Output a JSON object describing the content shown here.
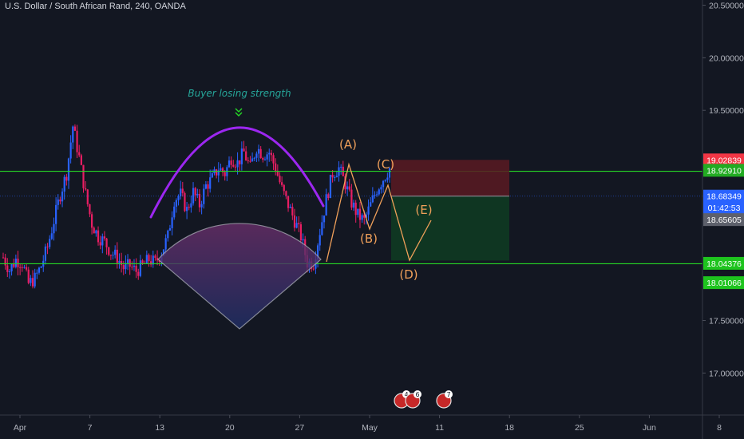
{
  "header": {
    "title": "U.S. Dollar / South African Rand, 240, OANDA"
  },
  "colors": {
    "background": "#131722",
    "up": "#2962ff",
    "down": "#e91e63",
    "support": "#26d926",
    "arc": "#9c27f0",
    "wave": "#f0a05a",
    "loss_zone": "#5a1a22",
    "profit_zone": "#0f3a22",
    "annotation": "#26a69a"
  },
  "chart_data": {
    "type": "candlestick",
    "title": "U.S. Dollar / South African Rand, 240, OANDA",
    "ylim": [
      16.6,
      20.55
    ],
    "y_ticks": [
      "20.50000",
      "20.00000",
      "19.50000",
      "17.50000",
      "17.00000"
    ],
    "x_ticks": [
      "Apr",
      "7",
      "13",
      "20",
      "27",
      "May",
      "11",
      "18",
      "25",
      "Jun",
      "8"
    ],
    "candle_series": [
      18.1,
      17.98,
      18.08,
      18.05,
      17.85,
      17.9,
      18.02,
      18.2,
      18.45,
      18.7,
      18.9,
      19.35,
      19.05,
      18.7,
      18.42,
      18.3,
      18.25,
      18.15,
      18.1,
      18.0,
      18.02,
      17.97,
      18.02,
      18.08,
      18.05,
      18.15,
      18.3,
      18.65,
      18.7,
      18.55,
      18.72,
      18.6,
      18.78,
      18.85,
      18.95,
      18.9,
      19.05,
      19.0,
      19.1,
      18.95,
      19.15,
      19.08,
      19.1,
      18.95,
      18.75,
      18.6,
      18.45,
      18.3,
      18.05,
      18.05,
      18.35,
      18.65,
      18.9,
      18.95,
      18.8,
      18.62,
      18.5,
      18.45,
      18.6,
      18.75,
      18.85,
      18.95
    ],
    "levels": {
      "resistance": 18.92,
      "support": 18.04,
      "target": 18.02
    },
    "price_labels": [
      {
        "text": "19.02839",
        "value": 19.02839,
        "color": "#f23645"
      },
      {
        "text": "18.92910",
        "value": 18.9291,
        "color": "#22ab22"
      },
      {
        "text": "18.68349",
        "value": 18.68349,
        "color": "#2962ff"
      },
      {
        "text": "01:42:53",
        "value": 18.575,
        "color": "#2962ff"
      },
      {
        "text": "18.65605",
        "value": 18.46,
        "color": "#5d606b"
      },
      {
        "text": "18.04376",
        "value": 18.04376,
        "color": "#1ec41e"
      },
      {
        "text": "18.01066",
        "value": 17.86,
        "color": "#1ec41e"
      }
    ],
    "annotations": {
      "buyer": "Buyer losing strength",
      "waves": [
        "(A)",
        "(B)",
        "(C)",
        "(D)",
        "(E)"
      ]
    },
    "event_badges": [
      "4",
      "6",
      "7"
    ]
  }
}
